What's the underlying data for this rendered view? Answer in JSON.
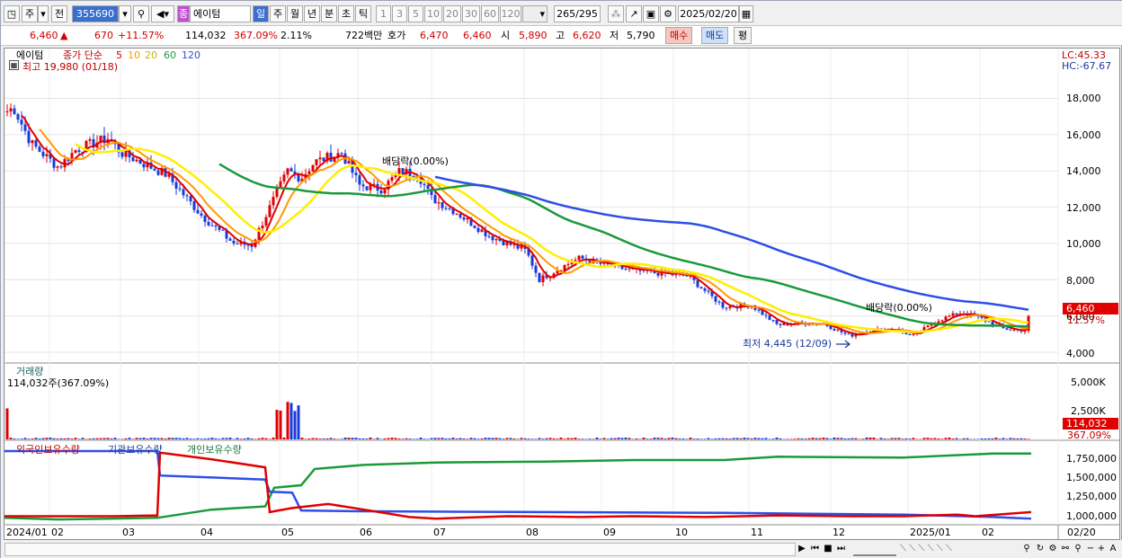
{
  "toolbar": {
    "market": "주",
    "prev_label": "전",
    "code": "355690",
    "name_tag": "종",
    "name": "에이텀",
    "periods": [
      "일",
      "주",
      "월",
      "년",
      "분",
      "초",
      "틱"
    ],
    "numbers": [
      "1",
      "3",
      "5",
      "10",
      "20",
      "30",
      "60",
      "120"
    ],
    "count": "265/295",
    "date": "2025/02/20",
    "icons": [
      "window-icon",
      "dropdown-icon",
      "search-icon",
      "speaker-icon",
      "tools-icon",
      "chart-tool-icon",
      "save-icon",
      "settings-icon",
      "calendar-icon"
    ]
  },
  "info": {
    "price": "6,460",
    "arrow": "▲",
    "change": "670",
    "change_pct": "+11.57%",
    "volume": "114,032",
    "volume_pct": "367.09%",
    "turnover": "2.11%",
    "amount": "722백만",
    "quote_label": "호가",
    "ask": "6,470",
    "bid": "6,460",
    "open_label": "시",
    "open": "5,890",
    "high_label": "고",
    "high": "6,620",
    "low_label": "저",
    "low": "5,790",
    "buy": "매수",
    "sell": "매도",
    "eval": "평"
  },
  "price_panel": {
    "name": "에이텀",
    "ma_title": "종가 단순",
    "ma_periods": [
      "5",
      "10",
      "20",
      "60",
      "120"
    ],
    "ma_colors": [
      "#e00000",
      "#ff9a00",
      "#ffee00",
      "#1a9a3a",
      "#2e4ee8"
    ],
    "high_note": "최고 19,980 (01/18)",
    "low_note": "최저 4,445 (12/09)",
    "div_note_1": "배당락(0.00%)",
    "div_note_2": "배당락(0.00%)",
    "lc": "LC:45.33",
    "hc": "HC:-67.67",
    "yaxis": [
      "18,000",
      "16,000",
      "14,000",
      "12,000",
      "10,000",
      "8,000",
      "6,000",
      "4,000"
    ],
    "last_price": "6,460",
    "last_pct": "11.57%"
  },
  "volume_panel": {
    "title": "거래량",
    "value": "114,032주(367.09%)",
    "yaxis": [
      "5,000K",
      "2,500K"
    ],
    "last": "114,032",
    "last_pct": "367.09%"
  },
  "holdings_panel": {
    "series": [
      "외국인보유수량",
      "기관보유수량",
      "개인보유수량"
    ],
    "colors": [
      "#e00000",
      "#2e4ee8",
      "#1a9a3a"
    ],
    "yaxis": [
      "1,750,000",
      "1,500,000",
      "1,250,000",
      "1,000,000"
    ]
  },
  "xaxis": [
    "2024/01",
    "02",
    "03",
    "04",
    "05",
    "06",
    "07",
    "08",
    "09",
    "10",
    "11",
    "12",
    "2025/01",
    "02",
    "02/20"
  ],
  "chart_data": {
    "type": "line",
    "x": [
      "2024/01",
      "02",
      "03",
      "04",
      "05",
      "06",
      "07",
      "08",
      "09",
      "10",
      "11",
      "12",
      "2025/01",
      "02",
      "02/20"
    ],
    "series": [
      {
        "name": "종가",
        "values": [
          17000,
          15000,
          14000,
          10000,
          14000,
          13500,
          11000,
          9000,
          8500,
          8000,
          6000,
          5000,
          5500,
          5200,
          6460
        ]
      }
    ],
    "ylim": [
      4000,
      19000
    ]
  }
}
